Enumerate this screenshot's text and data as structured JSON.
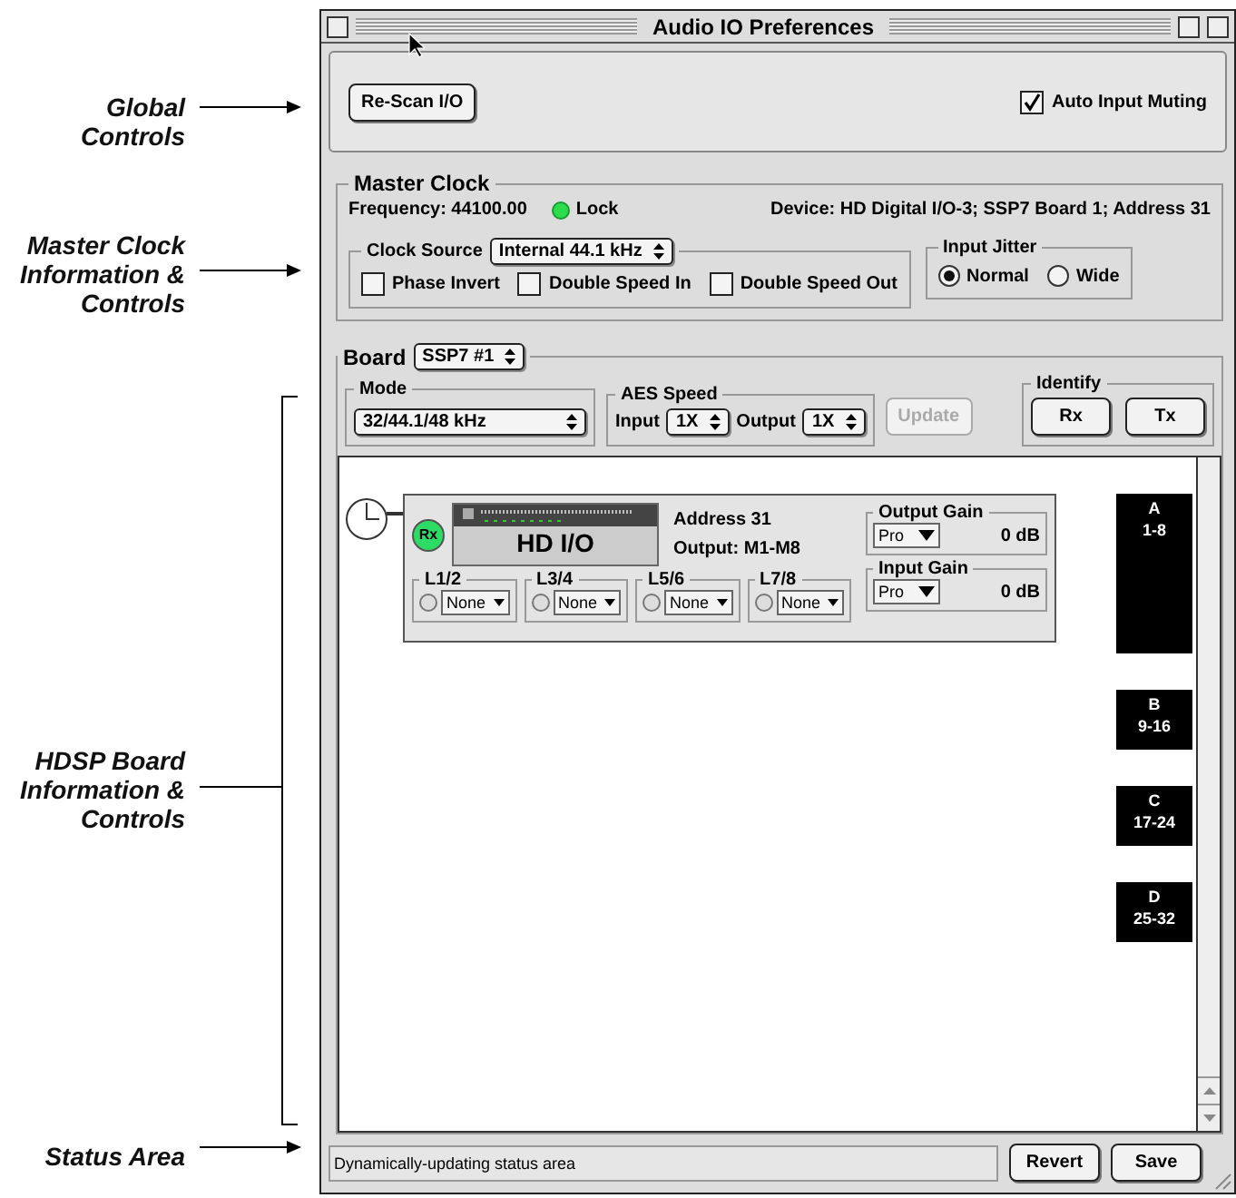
{
  "annotations": [
    {
      "kind": "arrow",
      "lines": [
        "Global",
        "Controls"
      ]
    },
    {
      "kind": "arrow",
      "lines": [
        "Master Clock",
        "Information &",
        "Controls"
      ]
    },
    {
      "kind": "bracket",
      "lines": [
        "HDSP Board",
        "Information &",
        "Controls"
      ]
    },
    {
      "kind": "arrow",
      "lines": [
        "Status Area"
      ]
    }
  ],
  "window": {
    "title": "Audio IO Preferences"
  },
  "global_controls": {
    "rescan_button": "Re-Scan I/O",
    "auto_input_muting": {
      "label": "Auto Input Muting",
      "checked": true
    }
  },
  "master_clock": {
    "title": "Master Clock",
    "frequency": "Frequency: 44100.00",
    "lock": {
      "label": "Lock",
      "on": true
    },
    "device": "Device: HD Digital I/O-3; SSP7 Board 1; Address 31",
    "clock_source": {
      "label": "Clock Source",
      "value": "Internal 44.1 kHz"
    },
    "options": [
      {
        "label": "Phase Invert",
        "checked": false
      },
      {
        "label": "Double Speed In",
        "checked": false
      },
      {
        "label": "Double Speed Out",
        "checked": false
      }
    ],
    "input_jitter": {
      "title": "Input Jitter",
      "options": [
        {
          "label": "Normal",
          "selected": true
        },
        {
          "label": "Wide",
          "selected": false
        }
      ]
    }
  },
  "board": {
    "label": "Board",
    "value": "SSP7 #1",
    "mode": {
      "title": "Mode",
      "value": "32/44.1/48 kHz"
    },
    "aes_speed": {
      "title": "AES Speed",
      "input_label": "Input",
      "input_value": "1X",
      "output_label": "Output",
      "output_value": "1X"
    },
    "update_button": {
      "label": "Update",
      "disabled": true
    },
    "identify": {
      "title": "Identify",
      "buttons": [
        "Rx",
        "Tx"
      ]
    },
    "device": {
      "badge": "Rx",
      "name": "HD I/O",
      "address": "Address 31",
      "output": "Output: M1-M8",
      "ports": [
        {
          "title": "L1/2",
          "value": "None",
          "led": false
        },
        {
          "title": "L3/4",
          "value": "None",
          "led": false
        },
        {
          "title": "L5/6",
          "value": "None",
          "led": false
        },
        {
          "title": "L7/8",
          "value": "None",
          "led": false
        }
      ],
      "gains": [
        {
          "title": "Output Gain",
          "mode": "Pro",
          "value": "0 dB"
        },
        {
          "title": "Input Gain",
          "mode": "Pro",
          "value": "0 dB"
        }
      ]
    },
    "channel_blocks": [
      {
        "letter": "A",
        "range": "1-8",
        "connected": true
      },
      {
        "letter": "B",
        "range": "9-16",
        "connected": false
      },
      {
        "letter": "C",
        "range": "17-24",
        "connected": false
      },
      {
        "letter": "D",
        "range": "25-32",
        "connected": false
      }
    ]
  },
  "status": {
    "text": "Dynamically-updating status area",
    "buttons": [
      "Revert",
      "Save"
    ]
  }
}
